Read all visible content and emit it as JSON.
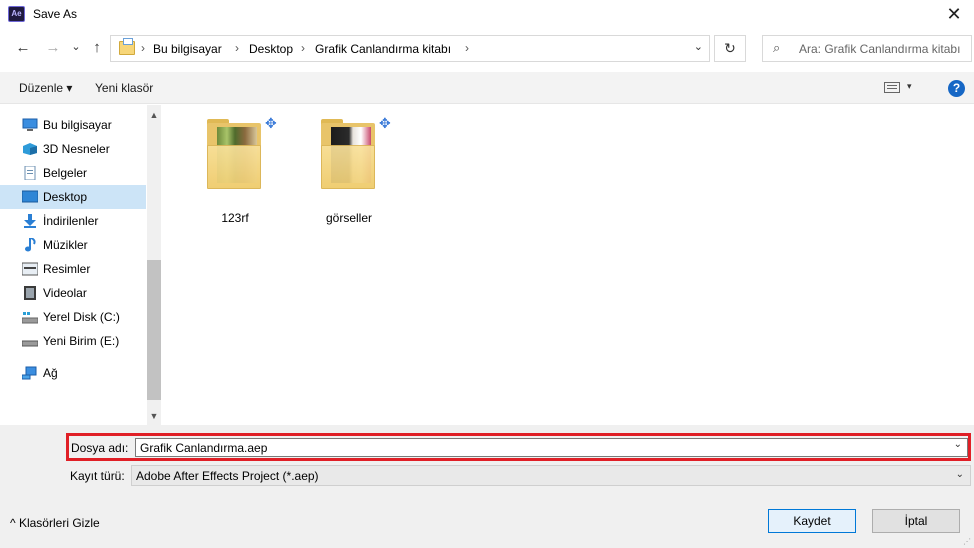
{
  "window": {
    "app_icon": "Ae",
    "title": "Save As",
    "close": "✕"
  },
  "nav": {
    "back": "←",
    "forward": "→",
    "recent": "⌄",
    "up": "↑",
    "breadcrumbs": [
      "Bu bilgisayar",
      "Desktop",
      "Grafik Canlandırma kitabı"
    ],
    "separator": "›",
    "dropdown": "⌄",
    "refresh": "↻",
    "search_placeholder": "Ara: Grafik Canlandırma kitabı"
  },
  "toolbar": {
    "organize": "Düzenle ▾",
    "new_folder": "Yeni klasör",
    "view_dropdown": "▾",
    "help": "?"
  },
  "sidebar": {
    "items": [
      {
        "label": "Bu bilgisayar",
        "icon": "computer-icon"
      },
      {
        "label": "3D Nesneler",
        "icon": "3d-objects-icon"
      },
      {
        "label": "Belgeler",
        "icon": "documents-icon"
      },
      {
        "label": "Desktop",
        "icon": "desktop-icon",
        "selected": true
      },
      {
        "label": "İndirilenler",
        "icon": "downloads-icon"
      },
      {
        "label": "Müzikler",
        "icon": "music-icon"
      },
      {
        "label": "Resimler",
        "icon": "pictures-icon"
      },
      {
        "label": "Videolar",
        "icon": "videos-icon"
      },
      {
        "label": "Yerel Disk (C:)",
        "icon": "drive-c-icon"
      },
      {
        "label": "Yeni Birim (E:)",
        "icon": "drive-e-icon"
      },
      {
        "label": "Ağ",
        "icon": "network-icon"
      }
    ],
    "scroll_up": "▲",
    "scroll_down": "▼"
  },
  "files": [
    {
      "name": "123rf",
      "icon": "folder-icon"
    },
    {
      "name": "görseller",
      "icon": "folder-icon"
    }
  ],
  "form": {
    "filename_label": "Dosya adı:",
    "filename_value": "Grafik Canlandırma.aep",
    "filetype_label": "Kayıt türü:",
    "filetype_value": "Adobe After Effects Project (*.aep)",
    "dropdown": "⌄"
  },
  "footer": {
    "hide_folders": "^  Klasörleri Gizle",
    "save": "Kaydet",
    "cancel": "İptal"
  },
  "colors": {
    "highlight_border": "#e01f26",
    "selection": "#cce4f7",
    "help": "#1667c5"
  }
}
